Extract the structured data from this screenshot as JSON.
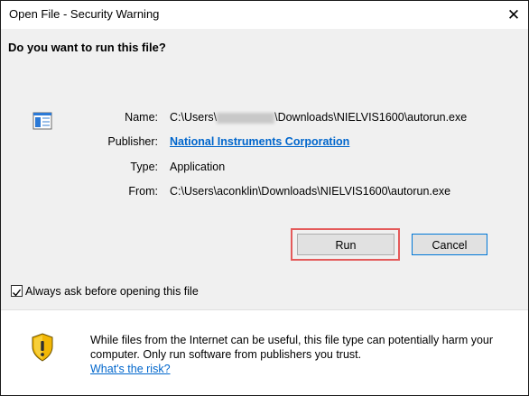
{
  "window": {
    "title": "Open File - Security Warning",
    "close_glyph": "✕"
  },
  "prompt": {
    "question": "Do you want to run this file?"
  },
  "details": {
    "name_label": "Name:",
    "name_prefix": "C:\\Users\\",
    "name_suffix": "\\Downloads\\NIELVIS1600\\autorun.exe",
    "publisher_label": "Publisher:",
    "publisher_value": "National Instruments Corporation",
    "type_label": "Type:",
    "type_value": "Application",
    "from_label": "From:",
    "from_value": "C:\\Users\\aconklin\\Downloads\\NIELVIS1600\\autorun.exe"
  },
  "buttons": {
    "run": "Run",
    "cancel": "Cancel"
  },
  "checkbox": {
    "label": "Always ask before opening this file",
    "checked": true
  },
  "warning": {
    "text": "While files from the Internet can be useful, this file type can potentially harm your computer. Only run software from publishers you trust.",
    "link": "What's the risk?"
  },
  "colors": {
    "link": "#0066cc",
    "highlight": "#e45a5a",
    "shield_yellow": "#f2b705",
    "shield_dark": "#2f2f2f"
  }
}
